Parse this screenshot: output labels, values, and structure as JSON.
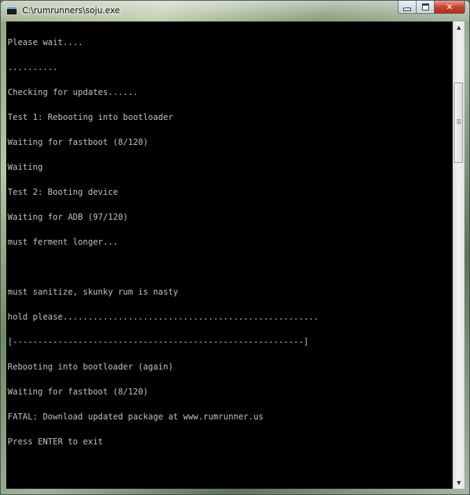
{
  "window": {
    "title": "C:\\rumrunners\\soju.exe",
    "icon": "console-app-icon",
    "buttons": {
      "minimize": "minimize-icon",
      "maximize": "maximize-icon",
      "close": "✕"
    }
  },
  "console": {
    "background": "#000000",
    "text_color": "#c0c0c0",
    "lines": [
      "Please wait....",
      "..........",
      "Checking for updates......",
      "Test 1: Rebooting into bootloader",
      "Waiting for fastboot (8/120)",
      "Waiting",
      "Test 2: Booting device",
      "Waiting for ADB (97/120)",
      "must ferment longer...",
      "",
      "must sanitize, skunky rum is nasty",
      "hold please...................................................",
      "[----------------------------------------------------------]",
      "Rebooting into bootloader (again)",
      "Waiting for fastboot (8/120)",
      "FATAL: Download updated package at www.rumrunner.us",
      "Press ENTER to exit"
    ]
  },
  "scrollbar": {
    "up_arrow": "▲",
    "down_arrow": "▼"
  }
}
